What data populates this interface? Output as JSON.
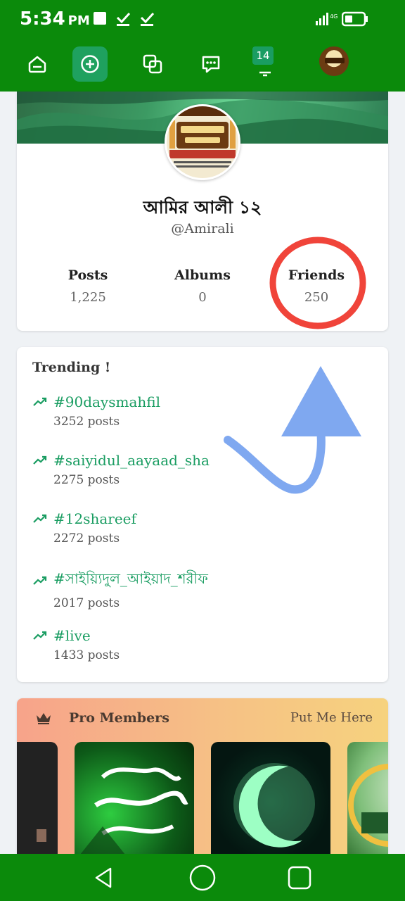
{
  "status_bar": {
    "time": "5:34",
    "ampm": "PM"
  },
  "nav": {
    "notification_count": "14"
  },
  "profile": {
    "name": "আমির আলী ১২",
    "handle": "@Amirali",
    "stats": [
      {
        "label": "Posts",
        "value": "1,225"
      },
      {
        "label": "Albums",
        "value": "0"
      },
      {
        "label": "Friends",
        "value": "250"
      }
    ]
  },
  "trending": {
    "title": "Trending !",
    "items": [
      {
        "tag": "#90daysmahfil",
        "count": "3252 posts"
      },
      {
        "tag": "#saiyidul_aayaad_sha",
        "count": "2275 posts"
      },
      {
        "tag": "#12shareef",
        "count": "2272 posts"
      },
      {
        "tag": "#সাইয়্যিদুল_আইয়াদ_শরীফ",
        "count": "2017 posts"
      },
      {
        "tag": "#live",
        "count": "1433 posts"
      }
    ]
  },
  "pro_members": {
    "title": "Pro Members",
    "link": "Put Me Here"
  },
  "colors": {
    "brand_green": "#0b8a0b",
    "accent_green": "#1a9d62",
    "annotation_red": "#f0443a",
    "annotation_blue": "#7fa8f0"
  }
}
